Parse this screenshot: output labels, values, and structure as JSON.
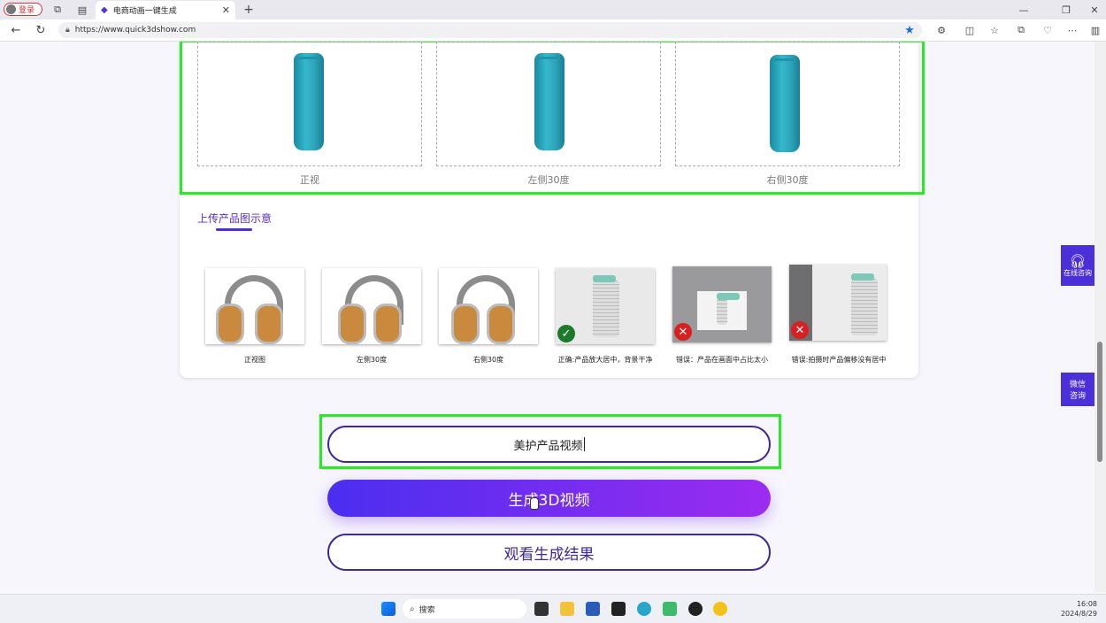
{
  "browser": {
    "login_label": "登录",
    "tab_title": "电商动画一键生成",
    "url": "https://www.quick3dshow.com"
  },
  "views": [
    {
      "label": "正视"
    },
    {
      "label": "左侧30度"
    },
    {
      "label": "右侧30度"
    }
  ],
  "example_section": {
    "title": "上传产品图示意",
    "samples": [
      {
        "label": "正视图"
      },
      {
        "label": "左侧30度"
      },
      {
        "label": "右侧30度"
      },
      {
        "label": "正确:产品放大居中，背景干净"
      },
      {
        "label": "错误：产品在画面中占比太小"
      },
      {
        "label": "错误:拍摄时产品偏移没有居中"
      }
    ]
  },
  "form": {
    "name_input_value": "美护产品视频",
    "generate_label": "生成3D视频",
    "view_result_label": "观看生成结果"
  },
  "side": {
    "online_label": "在线咨询",
    "wechat_label_1": "微信",
    "wechat_label_2": "咨询"
  },
  "taskbar": {
    "search_label": "搜索",
    "time": "16:08",
    "date": "2024/8/29"
  },
  "colors": {
    "accent": "#4b2fd8",
    "gradient_start": "#4a2ef0",
    "gradient_end": "#9b2cf0",
    "highlight": "#22ee22"
  }
}
